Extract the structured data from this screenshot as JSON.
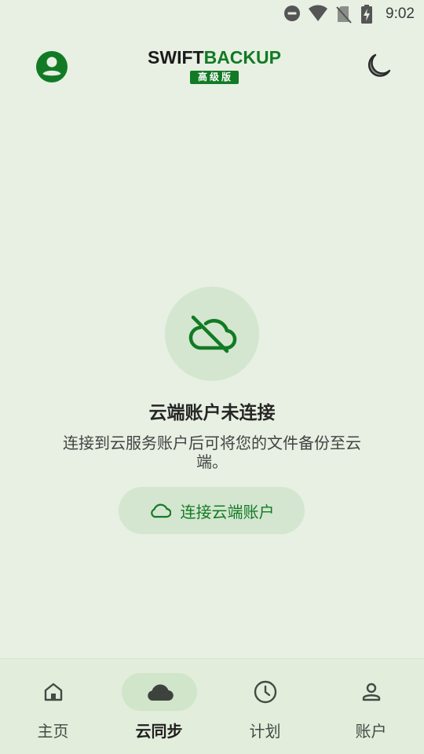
{
  "status_bar": {
    "time": "9:02",
    "icons": [
      "do-not-disturb-icon",
      "wifi-icon",
      "no-sim-icon",
      "battery-charging-icon"
    ]
  },
  "app_bar": {
    "logo_part1": "SWIFT",
    "logo_part2": "BACKUP",
    "badge": "高级版",
    "left_icon": "account-circle-icon",
    "right_icon": "dark-mode-moon-icon"
  },
  "empty_state": {
    "icon": "cloud-off-icon",
    "title": "云端账户未连接",
    "description": "连接到云服务账户后可将您的文件备份至云端。",
    "button_label": "连接云端账户",
    "button_icon": "cloud-outline-icon"
  },
  "bottom_nav": {
    "items": [
      {
        "label": "主页",
        "icon": "home-icon",
        "active": false
      },
      {
        "label": "云同步",
        "icon": "cloud-icon",
        "active": true
      },
      {
        "label": "计划",
        "icon": "clock-icon",
        "active": false
      },
      {
        "label": "账户",
        "icon": "person-icon",
        "active": false
      }
    ]
  },
  "colors": {
    "background": "#e7f0e2",
    "accent": "#127a25",
    "tonal_container": "#d4e6cf"
  }
}
